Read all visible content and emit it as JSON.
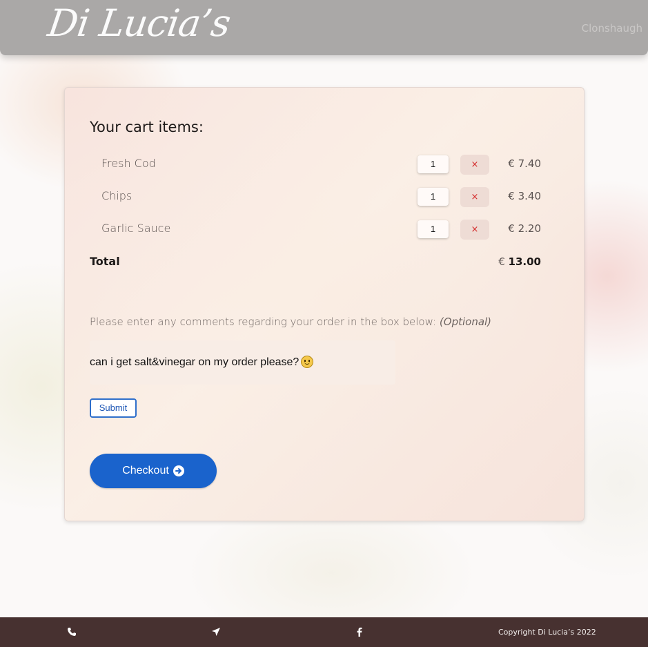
{
  "header": {
    "logo_text": "Di Lucia’s",
    "location": "Clonshaugh"
  },
  "cart": {
    "title": "Your cart items:",
    "currency": "€",
    "remove_symbol": "×",
    "items": [
      {
        "name": "Fresh Cod",
        "quantity": "1",
        "price": "€ 7.40"
      },
      {
        "name": "Chips",
        "quantity": "1",
        "price": "€ 3.40"
      },
      {
        "name": "Garlic Sauce",
        "quantity": "1",
        "price": "€ 2.20"
      }
    ],
    "total_label": "Total",
    "total_amount": "13.00"
  },
  "comments": {
    "label": "Please enter any comments regarding your order in the box below:",
    "optional": "(Optional)",
    "value": "can i get salt&vinegar on  my order please?",
    "submit_label": "Submit"
  },
  "checkout": {
    "label": "Checkout"
  },
  "footer": {
    "icons": [
      "phone-icon",
      "location-arrow-icon",
      "facebook-icon"
    ],
    "copyright": "Copyright Di Lucia’s 2022"
  },
  "colors": {
    "header_bg": "#aaa8a7",
    "footer_bg": "#473130",
    "checkout_bg": "#1a63cc",
    "remove_x": "#d42b2b"
  }
}
